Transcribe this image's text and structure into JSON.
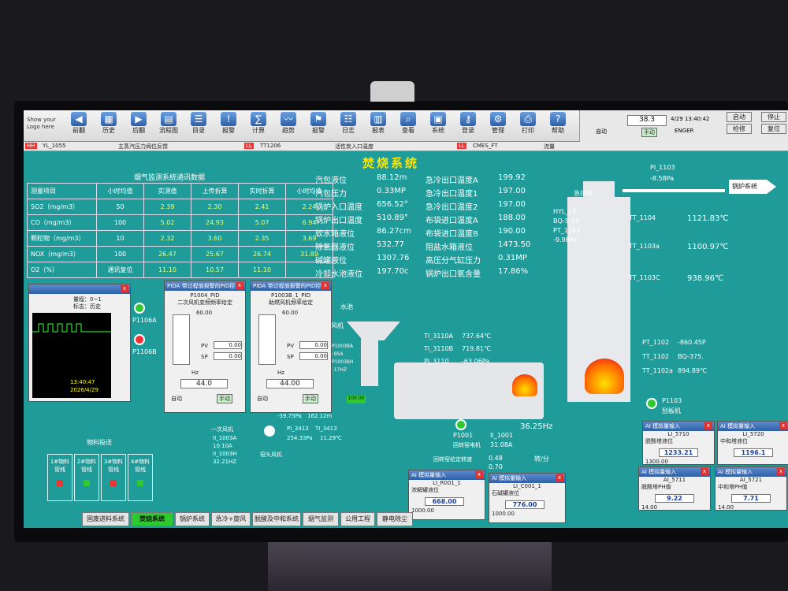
{
  "toolbar": {
    "logo": "Show your Logo here",
    "buttons": [
      "前翻",
      "历史",
      "后翻",
      "流程图",
      "目录",
      "报警",
      "计算",
      "趋势",
      "报警",
      "日志",
      "报表",
      "查看",
      "系统",
      "登录",
      "管理",
      "打印",
      "帮助"
    ]
  },
  "right_panel": {
    "setpoint": "38.3",
    "datetime": "4/29 13:40:42",
    "mode_auto": "自动",
    "mode_manual": "手动",
    "engineer": "ENGER",
    "btn_start": "启动",
    "btn_check": "检修",
    "btn_am": "A/M",
    "btn_stop": "停止",
    "btn_reset": "复位"
  },
  "alarm_bar": {
    "items": [
      "HH",
      "YL_1055",
      "主蒸汽压力阀位反馈",
      "LL",
      "TT1206",
      "活性炭入口温度",
      "LL",
      "CMES_FT",
      "流量"
    ]
  },
  "title": "焚烧系统",
  "emissions": {
    "caption": "烟气监测系统通讯数据",
    "headers": [
      "测量项目",
      "小时均值",
      "实测值",
      "上传折算",
      "实时折算",
      "小时均值"
    ],
    "rows": [
      [
        "SO2（mg/m3）",
        "50",
        "2.39",
        "2.30",
        "2.41",
        "2.24"
      ],
      [
        "CO（mg/m3）",
        "100",
        "5.02",
        "24.93",
        "5.07",
        "6.94"
      ],
      [
        "颗粒物（mg/m3）",
        "10",
        "2.32",
        "3.60",
        "2.35",
        "3.69"
      ],
      [
        "NOX（mg/m3）",
        "100",
        "26.47",
        "25.67",
        "26.74",
        "31.89"
      ],
      [
        "O2（%）",
        "通讯复位",
        "11.10",
        "10.57",
        "11.10",
        ""
      ]
    ]
  },
  "params_left": [
    {
      "label": "汽包液位",
      "value": "88.12m"
    },
    {
      "label": "汽包压力",
      "value": "0.33MP"
    },
    {
      "label": "锅炉入口温度",
      "value": "656.52°"
    },
    {
      "label": "锅炉出口温度",
      "value": "510.89°"
    },
    {
      "label": "软水箱液位",
      "value": "86.27cm"
    },
    {
      "label": "除氧器液位",
      "value": "532.77"
    },
    {
      "label": "碱罐液位",
      "value": "1307.76"
    },
    {
      "label": "冷却水池液位",
      "value": "197.70c"
    }
  ],
  "params_right": [
    {
      "label": "急冷出口温度A",
      "value": "199.92"
    },
    {
      "label": "急冷出口温度1",
      "value": "197.00"
    },
    {
      "label": "急冷出口温度2",
      "value": "197.00"
    },
    {
      "label": "布袋进口温度A",
      "value": "188.00"
    },
    {
      "label": "布袋进口温度B",
      "value": "190.00"
    },
    {
      "label": "阻盐水箱液位",
      "value": "1473.50"
    },
    {
      "label": "高压分气缸压力",
      "value": "0.31MP"
    },
    {
      "label": "锅炉出口氧含量",
      "value": "17.86%"
    }
  ],
  "boiler": {
    "pi_1103_tag": "PI_1103",
    "pi_1103_val": "-8.58Pa",
    "outlet": "锅炉系统",
    "vent": "急排阀",
    "hyl_er": "HYL_ER",
    "bq": "BQ-5.15",
    "pt_1103": "PT_1103",
    "pt_1103_val": "-9.98Pa",
    "tt": [
      {
        "tag": "TT_1104",
        "val": "1121.83℃"
      },
      {
        "tag": "TT_1103a",
        "val": "1100.97℃"
      },
      {
        "tag": "TT_1103C",
        "val": "938.96℃"
      }
    ],
    "pt_1102_tag": "PT_1102",
    "pt_1102_val": "-860.45P",
    "tt_1102": "TT_1102",
    "tt_1102_val": "BQ-375.",
    "tt_1102a": "TT_1102a",
    "tt_1102a_val": "894.89℃",
    "p1103": "P1103",
    "p1103_sub": "刮板机"
  },
  "kiln": {
    "ti_3110a": "TI_3110A",
    "ti_3110a_val": "737.64℃",
    "ti_3110b": "TI_3110B",
    "ti_3110b_val": "719.81℃",
    "pi_3110": "PI_3110",
    "pi_3110_val": "-63.06Pa",
    "feed_label": "料斗",
    "flow": "100.00",
    "p1001": "P1001",
    "p1001_sub": "回转窑电机",
    "ii_1001": "II_1001",
    "ii_1001_val": "31.08A",
    "hz": "36.25Hz",
    "speed_set_label": "回转窑给定转速",
    "speed_set": "0.48",
    "speed_act": "0.70",
    "unit": "转/分"
  },
  "fans": {
    "p1106a": "P1106A",
    "p1106b": "P1106B",
    "label_water": "水池",
    "label_fan": "风机",
    "pi_3413": "PI_3413",
    "ti_3413": "TI_3413",
    "pi_3413_val": "254.33Pa",
    "ti_3413_val": "11.29℃",
    "kiln_fan": "窑头风机",
    "secondary_fan": "一次风机",
    "ii_1003a": "II_1003A",
    "ii_1003a_val": "10.10A",
    "ii_1003b": "II_1003H",
    "ii_1003b_val": "32.21HZ",
    "p_val": "-39.75Pa",
    "p_val2": "162.12m",
    "i_0095": "0.95A",
    "p1003ba": "_P1003BA",
    "p1003bh": "_P1003BH",
    "hz_717": "7.17HZ"
  },
  "material": {
    "title": "物料投送",
    "lines": [
      "1#物料管线",
      "2#物料管线",
      "3#物料管线",
      "4#物料管线"
    ]
  },
  "trend_window": {
    "range": "量程：0~1",
    "mode": "标志：历史",
    "time": "13:40:47",
    "date": "2026/4/29"
  },
  "pid1": {
    "header": "PIDA 带过程值报警的PID控制",
    "tag": "P1004_PID",
    "desc": "二次风机变频频率给定",
    "scale": "60.00",
    "pv": "0.00",
    "sp": "0.00",
    "out": "44.0",
    "unit": "Hz",
    "auto": "自动",
    "manual": "手动"
  },
  "pid2": {
    "header": "PIDA 带过程值报警的PID控制",
    "tag": "P1003B_1_PID",
    "desc": "助燃风机频率给定",
    "scale": "60.00",
    "pv": "0.00",
    "sp": "0.00",
    "out": "44.00",
    "unit": "Hz",
    "auto": "自动",
    "manual": "手动"
  },
  "ai_windows": [
    {
      "header": "AI 模拟量输入",
      "tag": "LI_R001_1",
      "desc": "浓解罐液位",
      "val": "668.00",
      "low": "1000.00"
    },
    {
      "header": "AI 模拟量输入",
      "tag": "LI_C001_1",
      "desc": "石碱罐液位",
      "val": "776.00",
      "low": "1000.00"
    },
    {
      "header": "AI 模拟量输入",
      "tag": "LI_5710",
      "desc": "脱酸塔液位",
      "val": "1233.21",
      "low": "1300.00"
    },
    {
      "header": "AI 模拟量输入",
      "tag": "LI_5720",
      "desc": "中和塔液位",
      "val": "1196.1",
      "low": ""
    },
    {
      "header": "AI 模拟量输入",
      "tag": "AI_5711",
      "desc": "脱酸塔PH值",
      "val": "9.22",
      "low": "14.00"
    },
    {
      "header": "AI 模拟量输入",
      "tag": "AI_5721",
      "desc": "中和塔PH值",
      "val": "7.71",
      "low": "14.00"
    }
  ],
  "tabs": [
    "固废进料系统",
    "焚烧系统",
    "锅炉系统",
    "急冷+旋风",
    "脱酸及中和系统",
    "烟气监测",
    "公用工程",
    "静电除尘"
  ],
  "colors": {
    "bg": "#1f9c9a",
    "accent": "#ffe400",
    "active_tab": "#2ec92e"
  }
}
